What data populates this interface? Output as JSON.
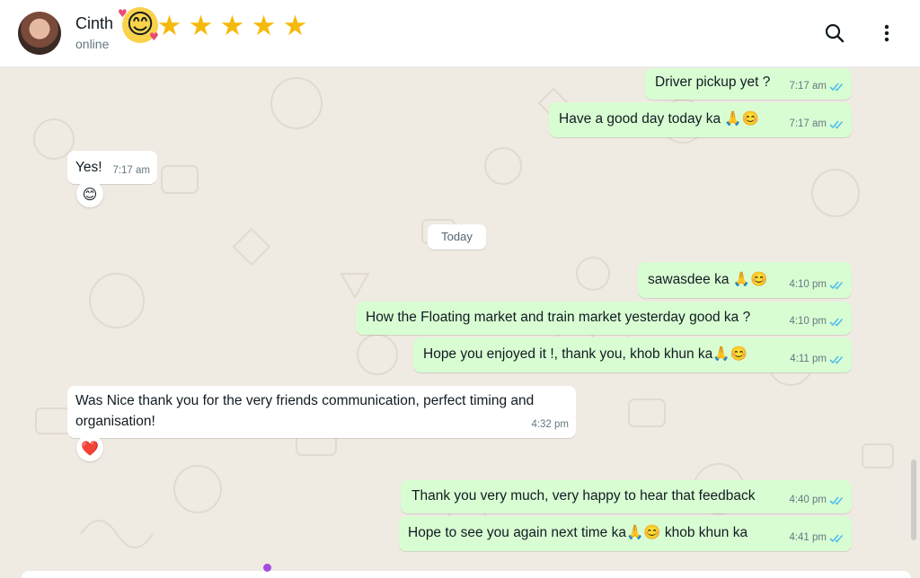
{
  "header": {
    "contact_name": "Cinth",
    "status": "online",
    "sticker_emoji": "😊",
    "star_glyph": "★",
    "star_count": 5,
    "icons": [
      "search-icon",
      "more-vertical-icon"
    ]
  },
  "date_divider": "Today",
  "messages": [
    {
      "text": "Driver pickup yet ?",
      "time": "7:17 am",
      "direction": "out"
    },
    {
      "text": "Have a good day today ka 🙏😊",
      "time": "7:17 am",
      "direction": "out"
    },
    {
      "text": "Yes!",
      "time": "7:17 am",
      "direction": "in",
      "reaction": "😊"
    },
    {
      "text": "sawasdee ka 🙏😊",
      "time": "4:10 pm",
      "direction": "out"
    },
    {
      "text": "How the Floating market and train market yesterday good ka ?",
      "time": "4:10 pm",
      "direction": "out"
    },
    {
      "text": "Hope you enjoyed it !, thank you, khob khun ka🙏😊",
      "time": "4:11 pm",
      "direction": "out"
    },
    {
      "text_lines": [
        "Was Nice thank you for the very friends communication, perfect timing and",
        "organisation!"
      ],
      "time": "4:32 pm",
      "direction": "in",
      "reaction": "❤️"
    },
    {
      "text": "Thank you very much, very happy to hear that feedback",
      "time": "4:40 pm",
      "direction": "out"
    },
    {
      "text": "Hope to see you again next time ka🙏😊 khob khun ka",
      "time": "4:41 pm",
      "direction": "out"
    }
  ],
  "colors": {
    "outgoing_bubble": "#d9fdd3",
    "incoming_bubble": "#ffffff",
    "wallpaper": "#efeae2",
    "read_ticks": "#53bdeb",
    "stars": "#f6b90e"
  }
}
